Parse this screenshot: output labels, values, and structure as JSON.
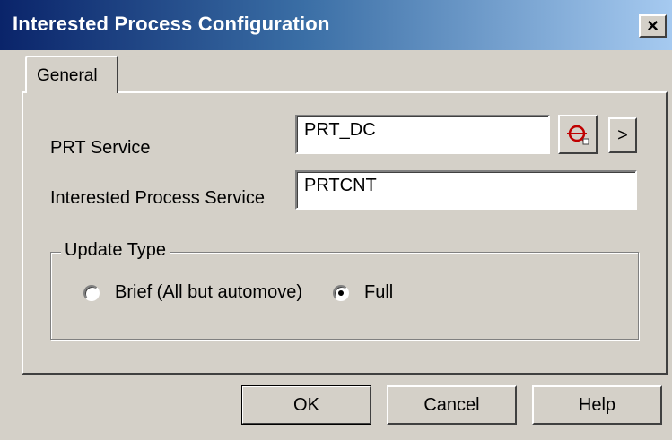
{
  "window": {
    "title": "Interested Process Configuration",
    "close_glyph": "×"
  },
  "tabs": [
    {
      "label": "General",
      "selected": true
    }
  ],
  "form": {
    "prt_service": {
      "label": "PRT Service",
      "value": "PRT_DC",
      "browse_icon": "search-icon",
      "next_label": ">"
    },
    "interested_service": {
      "label": "Interested Process Service",
      "value": "PRTCNT"
    }
  },
  "update_type": {
    "legend": "Update Type",
    "options": [
      {
        "label": "Brief (All but automove)",
        "selected": false
      },
      {
        "label": "Full",
        "selected": true
      }
    ]
  },
  "buttons": {
    "ok": "OK",
    "cancel": "Cancel",
    "help": "Help"
  },
  "colors": {
    "face": "#d4d0c8",
    "title_start": "#0a246a",
    "title_end": "#a6caf0",
    "icon_red": "#c00000"
  }
}
